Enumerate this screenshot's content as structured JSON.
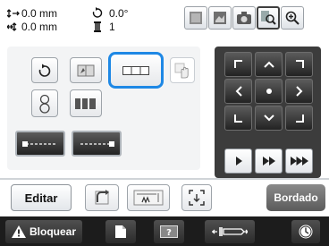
{
  "status": {
    "offset_x": "0.0 mm",
    "offset_y": "0.0 mm",
    "rotation": "0.0°",
    "thread_colors": "1"
  },
  "toolbar_top": {
    "icons": [
      "embroidery-frame-icon",
      "frame-alt-icon",
      "camera-preview-icon",
      "zoom-preview-icon",
      "zoom-in-icon"
    ]
  },
  "layout_panel": {
    "selected_button": "border-repeat-button",
    "icons": [
      "rotate-icon",
      "mirror-icon",
      "border-repeat-icon",
      "density-icon",
      "multi-color-icon",
      "array-icon",
      "thread-mark-left-icon",
      "thread-mark-right-icon"
    ]
  },
  "arrow_pad": {
    "icons": [
      "arrow-up-left-icon",
      "arrow-up-icon",
      "arrow-up-right-icon",
      "arrow-left-icon",
      "center-dot-icon",
      "arrow-right-icon",
      "arrow-down-left-icon",
      "arrow-down-icon",
      "arrow-down-right-icon"
    ]
  },
  "playback": {
    "icons": [
      "play-icon",
      "fast-forward-icon",
      "skip-forward-icon"
    ]
  },
  "bottom": {
    "edit_label": "Editar",
    "embroidery_label": "Bordado",
    "lock_label": "Bloquear"
  },
  "colors": {
    "accent": "#1e88e5",
    "dark_panel": "#3c3c3c",
    "bottom_bar": "#1c1c1c"
  }
}
